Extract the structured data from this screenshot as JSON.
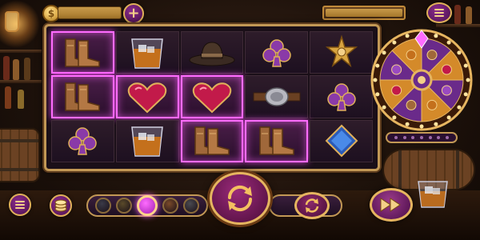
{
  "top_bar": {
    "coin_symbol": "$",
    "plus_symbol": "+",
    "balance_value": "",
    "win_value": ""
  },
  "reels": [
    [
      "boots",
      "whiskey-glass",
      "cowboy-hat",
      "club",
      "sheriff-star"
    ],
    [
      "boots",
      "heart",
      "heart",
      "belt-buckle",
      "club"
    ],
    [
      "club",
      "whiskey-glass",
      "boots",
      "boots",
      "diamond"
    ]
  ],
  "win_cells": [
    [
      0,
      0
    ],
    [
      1,
      0
    ],
    [
      1,
      1
    ],
    [
      1,
      2
    ],
    [
      2,
      2
    ],
    [
      2,
      3
    ]
  ],
  "wheel": {
    "segment_colors": [
      "#6a2a8a",
      "#d48a2a",
      "#6a2a8a",
      "#d48a2a",
      "#6a2a8a",
      "#d48a2a",
      "#6a2a8a",
      "#d48a2a"
    ],
    "segment_icons": [
      "boots",
      "heart",
      "club",
      "whiskey-glass",
      "boots",
      "heart",
      "club",
      "whiskey-glass"
    ],
    "pointer_icon": "diamond-pointer-icon"
  },
  "bet_chips": [
    {
      "color": "#3a3a48",
      "active": false
    },
    {
      "color": "#5a4a2a",
      "active": false
    },
    {
      "color": "#d040d0",
      "active": true
    },
    {
      "color": "#7a4a2a",
      "active": false
    },
    {
      "color": "#4a4a50",
      "active": false
    }
  ],
  "colors": {
    "accent_gold": "#e6b560",
    "win_highlight": "#ff6cff",
    "button_purple": "#8a2c8c"
  }
}
